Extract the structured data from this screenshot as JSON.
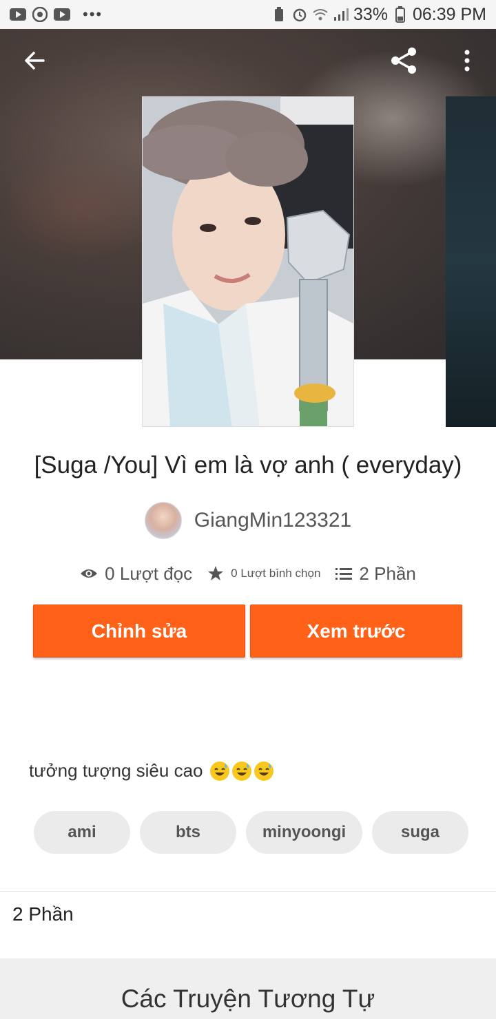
{
  "status_bar": {
    "battery": "33%",
    "time": "06:39 PM",
    "more": "•••"
  },
  "toolbar": {
    "back_icon": "arrow-left-icon",
    "share_icon": "share-icon",
    "menu_icon": "more-vertical-icon"
  },
  "story": {
    "title": "[Suga /You] Vì em là vợ anh ( everyday)",
    "author": "GiangMin123321",
    "reads": "0 Lượt đọc",
    "votes": "0 Lượt bình chọn",
    "parts": "2 Phần",
    "description": "tưởng tượng siêu cao"
  },
  "buttons": {
    "edit": "Chỉnh sửa",
    "preview": "Xem trước"
  },
  "tags": [
    "ami",
    "bts",
    "minyoongi",
    "suga"
  ],
  "parts_section": {
    "label": "2 Phần"
  },
  "similar_section": {
    "title": "Các Truyện Tương Tự"
  },
  "colors": {
    "accent": "#ff6119",
    "tag_bg": "#ebebeb"
  }
}
